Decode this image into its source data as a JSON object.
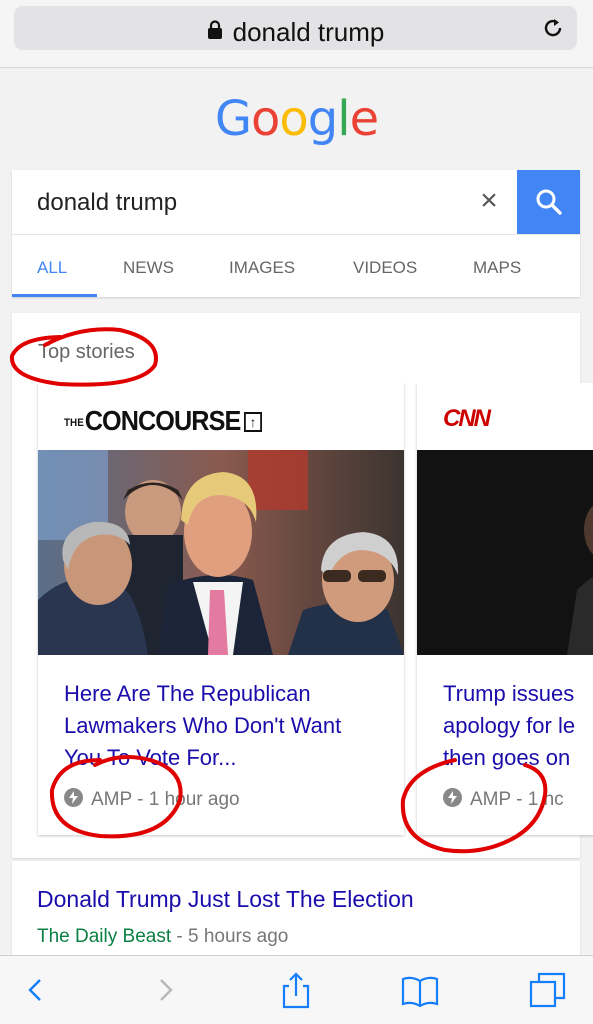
{
  "browser": {
    "url_text": "donald trump",
    "icons": {
      "lock": "lock-icon",
      "reload": "reload-icon"
    }
  },
  "google": {
    "logo_letters": [
      {
        "ch": "G",
        "color": "#4285f4"
      },
      {
        "ch": "o",
        "color": "#ea4335"
      },
      {
        "ch": "o",
        "color": "#fbbc05"
      },
      {
        "ch": "g",
        "color": "#4285f4"
      },
      {
        "ch": "l",
        "color": "#34a853"
      },
      {
        "ch": "e",
        "color": "#ea4335"
      }
    ],
    "search": {
      "query": "donald trump",
      "clear_glyph": "×",
      "button_icon": "search-icon"
    },
    "tabs": [
      {
        "label": "ALL",
        "active": true
      },
      {
        "label": "NEWS",
        "active": false
      },
      {
        "label": "IMAGES",
        "active": false
      },
      {
        "label": "VIDEOS",
        "active": false
      },
      {
        "label": "MAPS",
        "active": false
      }
    ]
  },
  "top_stories": {
    "heading": "Top stories",
    "stories": [
      {
        "publisher": "THE CONCOURSE",
        "publisher_prefix": "THE",
        "publisher_name": "CONCOURSE",
        "title": "Here Are The Republican Lawmakers Who Don't Want You To Vote For...",
        "amp": "AMP",
        "time": "1 hour ago"
      },
      {
        "publisher": "CNN",
        "title_lines": [
          "Trump issues",
          "apology for le",
          "then goes on"
        ],
        "amp": "AMP",
        "time": "1 hc"
      }
    ]
  },
  "result": {
    "title": "Donald Trump Just Lost The Election",
    "source": "The Daily Beast",
    "time": "5 hours ago"
  },
  "toolbar": {
    "buttons": [
      "back-icon",
      "forward-icon",
      "share-icon",
      "bookmarks-icon",
      "tabs-icon"
    ]
  },
  "colors": {
    "google_blue": "#4285f4",
    "link_blue": "#1a0dab",
    "source_green": "#0b8043",
    "ios_blue": "#147efb",
    "annotation_red": "#e00000"
  }
}
